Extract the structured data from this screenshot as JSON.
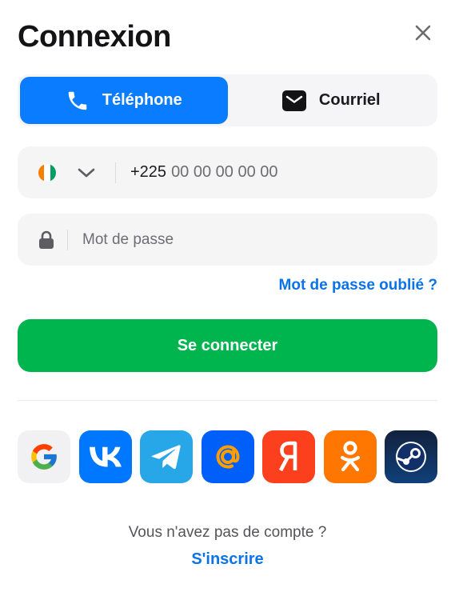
{
  "dialog": {
    "title": "Connexion",
    "close_icon": "close-icon"
  },
  "tabs": [
    {
      "label": "Téléphone",
      "icon": "phone-icon",
      "active": true
    },
    {
      "label": "Courriel",
      "icon": "envelope-icon",
      "active": false
    }
  ],
  "phone": {
    "country_flag": "Côte d'Ivoire flag",
    "flag_colors": [
      "#f77f00",
      "#ffffff",
      "#009e60"
    ],
    "dial_code": "+225",
    "placeholder": "00 00 00 00 00"
  },
  "password": {
    "placeholder": "Mot de passe",
    "icon": "lock-icon"
  },
  "forgot_label": "Mot de passe oublié ?",
  "submit_label": "Se connecter",
  "socials": [
    {
      "name": "google",
      "bg": "#f1f1f3"
    },
    {
      "name": "vk",
      "bg": "#0077ff"
    },
    {
      "name": "telegram",
      "bg": "#27a7e7"
    },
    {
      "name": "mail-ru",
      "bg": "#005ff9"
    },
    {
      "name": "yandex",
      "bg": "#fc3f1d"
    },
    {
      "name": "odnoklassniki",
      "bg": "#ff7700"
    },
    {
      "name": "steam",
      "bg": "#1b2838"
    }
  ],
  "footer": {
    "no_account": "Vous n'avez pas de compte ?",
    "signup_label": "S'inscrire"
  },
  "colors": {
    "accent_blue": "#0a7cff",
    "link_blue": "#0a73e8",
    "submit_green": "#00b54e"
  }
}
